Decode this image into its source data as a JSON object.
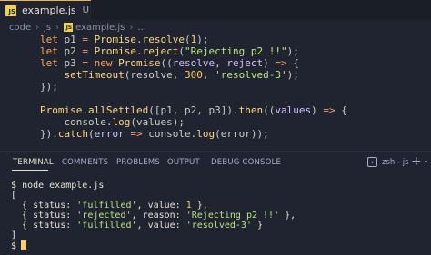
{
  "tab": {
    "badge": "JS",
    "filename": "example.js",
    "status": "U",
    "close": "×"
  },
  "breadcrumb": [
    "code",
    "js",
    "example.js",
    "..."
  ],
  "breadcrumb_separator": "›",
  "code": {
    "p1_var": "p1",
    "p2_var": "p2",
    "p3_var": "p3",
    "promise": "Promise",
    "resolve_fn": "resolve",
    "reject_fn": "reject",
    "num_1": "1",
    "str_reject": "\"Rejecting p2 !!\"",
    "new_kw": "new",
    "let_kw": "let",
    "params_resolve": "resolve",
    "params_reject": "reject",
    "set_timeout": "setTimeout",
    "num_300": "300",
    "str_resolved3": "'resolved-3'",
    "all_settled": "allSettled",
    "then_fn": "then",
    "values_param": "values",
    "console": "console",
    "log_fn": "log",
    "catch_fn": "catch",
    "error_param": "error"
  },
  "panel_tabs": [
    "TERMINAL",
    "COMMENTS",
    "PROBLEMS",
    "OUTPUT",
    "DEBUG CONSOLE"
  ],
  "shell": {
    "icon": "terminal-icon",
    "label": "zsh - js",
    "add_icon": "+",
    "dropdown_icon": "⌄"
  },
  "terminal": {
    "prompt": "$",
    "command": "node example.js",
    "open_bracket": "[",
    "close_bracket": "]",
    "rows": [
      {
        "status_key": "status:",
        "status": "'fulfilled'",
        "value_key": "value:",
        "value": "1",
        "tail": " },"
      },
      {
        "status_key": "status:",
        "status": "'rejected'",
        "value_key": "reason:",
        "value": "'Rejecting p2 !!'",
        "tail": " },"
      },
      {
        "status_key": "status:",
        "status": "'fulfilled'",
        "value_key": "value:",
        "value": "'resolved-3'",
        "tail": " }"
      }
    ]
  },
  "colors": {
    "background": "#1f2430",
    "accent": "#f0b354",
    "keyword": "#ffa759",
    "string": "#bae67e",
    "number": "#ffcc66"
  }
}
